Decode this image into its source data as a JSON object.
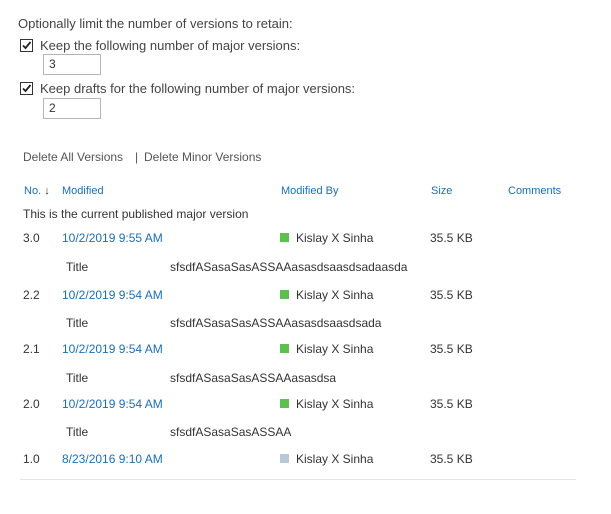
{
  "retention": {
    "heading": "Optionally limit the number of versions to retain:",
    "major": {
      "label": "Keep the following number of major versions:",
      "checked": true,
      "value": "3"
    },
    "drafts": {
      "label": "Keep drafts for the following number of major versions:",
      "checked": true,
      "value": "2"
    }
  },
  "actions": {
    "delete_all": "Delete All Versions",
    "separator": "|",
    "delete_minor": "Delete Minor Versions"
  },
  "table": {
    "headers": {
      "no": "No.",
      "sort_arrow": "↓",
      "modified": "Modified",
      "modified_by": "Modified By",
      "size": "Size",
      "comments": "Comments"
    },
    "current_note": "This is the current published major version",
    "rows": [
      {
        "no": "3.0",
        "modified": "10/2/2019 9:55 AM",
        "by": "Kislay X Sinha",
        "size": "35.5 KB",
        "presence_color": "#5cbf4f",
        "field": "Title",
        "field_value": "sfsdfASasaSasASSAAasasdsaasdsadaasda"
      },
      {
        "no": "2.2",
        "modified": "10/2/2019 9:54 AM",
        "by": "Kislay X Sinha",
        "size": "35.5 KB",
        "presence_color": "#5cbf4f",
        "field": "Title",
        "field_value": "sfsdfASasaSasASSAAasasdsaasdsada"
      },
      {
        "no": "2.1",
        "modified": "10/2/2019 9:54 AM",
        "by": "Kislay X Sinha",
        "size": "35.5 KB",
        "presence_color": "#5cbf4f",
        "field": "Title",
        "field_value": "sfsdfASasaSasASSAAasasdsa"
      },
      {
        "no": "2.0",
        "modified": "10/2/2019 9:54 AM",
        "by": "Kislay X Sinha",
        "size": "35.5 KB",
        "presence_color": "#5cbf4f",
        "field": "Title",
        "field_value": "sfsdfASasaSasASSAA"
      },
      {
        "no": "1.0",
        "modified": "8/23/2016 9:10 AM",
        "by": "Kislay X Sinha",
        "size": "35.5 KB",
        "presence_color": "#b7c9d6"
      }
    ]
  }
}
